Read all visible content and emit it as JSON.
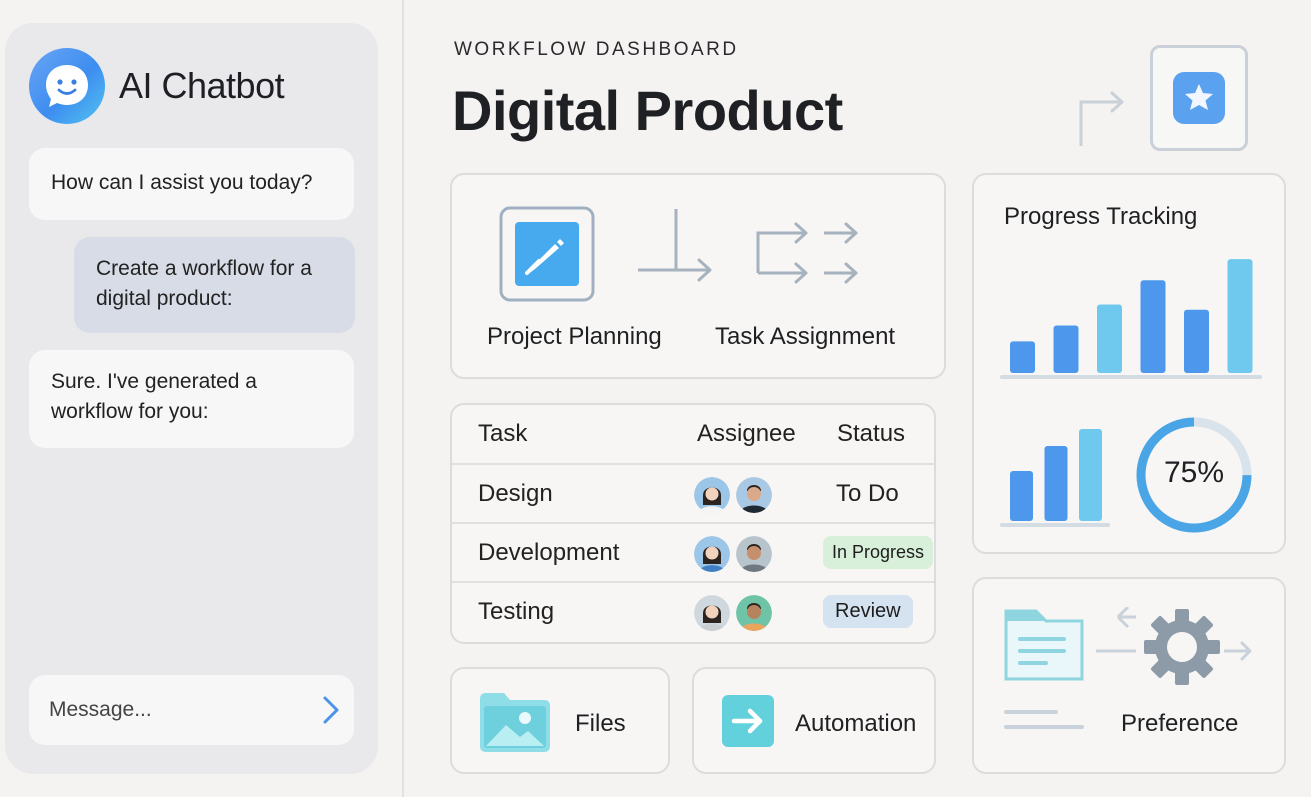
{
  "chat": {
    "title": "AI Chatbot",
    "messages": [
      {
        "role": "bot",
        "text": "How can I assist you today?"
      },
      {
        "role": "user",
        "text": "Create a workflow for a digital product:"
      },
      {
        "role": "bot",
        "text": "Sure. I've generated a workflow for you:"
      }
    ],
    "input_placeholder": "Message..."
  },
  "header": {
    "eyebrow": "WORKFLOW DASHBOARD",
    "title": "Digital Product"
  },
  "workflow": {
    "steps": [
      "Project Planning",
      "Task Assignment"
    ]
  },
  "tasks": {
    "columns": [
      "Task",
      "Assignee",
      "Status"
    ],
    "rows": [
      {
        "task": "Design",
        "status": "To Do"
      },
      {
        "task": "Development",
        "status": "In Progress"
      },
      {
        "task": "Testing",
        "status": "Review"
      }
    ]
  },
  "tiles": {
    "files": "Files",
    "automation": "Automation",
    "preference": "Preference"
  },
  "progress": {
    "title": "Progress Tracking",
    "percent_label": "75%",
    "percent": 75
  },
  "chart_data": [
    {
      "type": "bar",
      "values": [
        3,
        4.5,
        6.5,
        8.8,
        6,
        10.8
      ]
    },
    {
      "type": "bar",
      "values": [
        5,
        7.5,
        9.2
      ]
    }
  ],
  "colors": {
    "accent_blue": "#4d98ec",
    "light_blue": "#6fc8ee",
    "teal": "#5fcfd8",
    "badge_green": "#d8efd9",
    "badge_blue": "#d5e2ef"
  }
}
